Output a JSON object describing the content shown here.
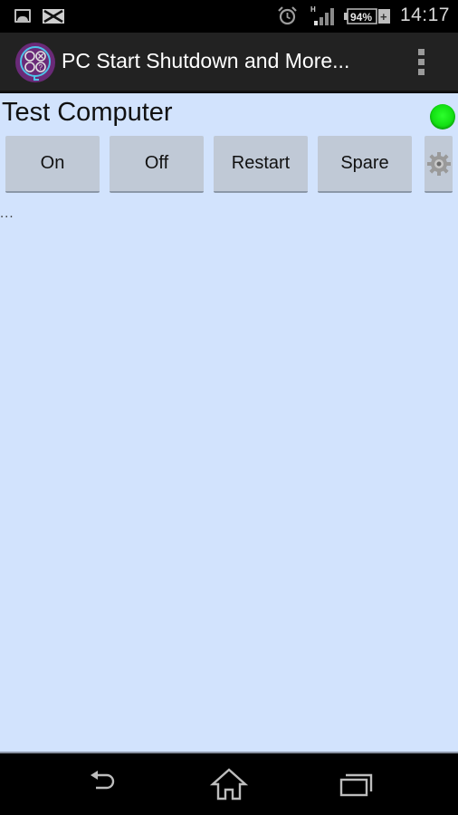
{
  "status_bar": {
    "icons": [
      "gallery-icon",
      "mail-icon",
      "alarm-icon",
      "signal-icon",
      "battery-icon"
    ],
    "network_type": "H",
    "battery_percent": "94%",
    "battery_charging": "+",
    "time": "14:17"
  },
  "action_bar": {
    "app_icon": "app-logo-icon",
    "title": "PC Start Shutdown and More...",
    "overflow_icon": "overflow-menu-icon"
  },
  "main": {
    "computer_name": "Test Computer",
    "status_indicator": {
      "state": "online",
      "color": "#1ee61e"
    },
    "buttons": [
      {
        "label": "On"
      },
      {
        "label": "Off"
      },
      {
        "label": "Restart"
      },
      {
        "label": "Spare"
      }
    ],
    "settings_icon": "gear-icon",
    "log": "..."
  },
  "nav_bar": {
    "back": "back-icon",
    "home": "home-icon",
    "recents": "recents-icon"
  },
  "colors": {
    "content_bg": "#d2e3fd",
    "button_bg": "#c0c9d6",
    "action_bar_bg": "#222222",
    "status_led": "#1ee61e"
  }
}
